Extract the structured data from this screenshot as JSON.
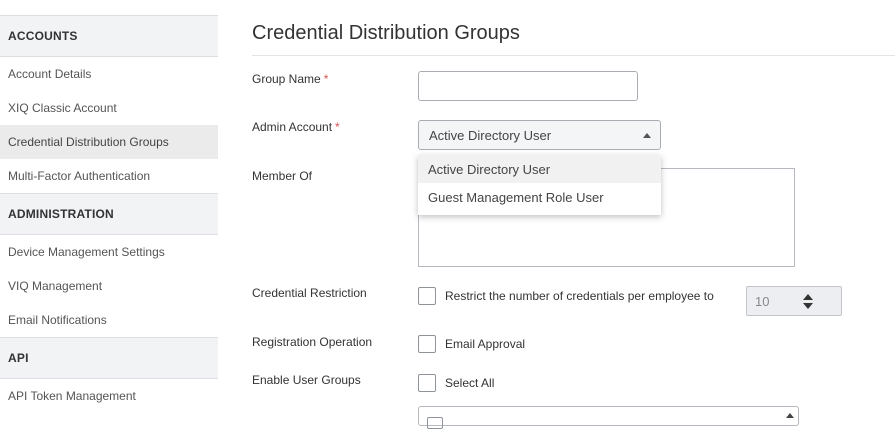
{
  "sidebar": {
    "sections": [
      {
        "title": "ACCOUNTS",
        "items": [
          "Account Details",
          "XIQ Classic Account",
          "Credential Distribution Groups",
          "Multi-Factor Authentication"
        ]
      },
      {
        "title": "ADMINISTRATION",
        "items": [
          "Device Management Settings",
          "VIQ Management",
          "Email Notifications"
        ]
      },
      {
        "title": "API",
        "items": [
          "API Token Management"
        ]
      }
    ],
    "active_item": "Credential Distribution Groups"
  },
  "main": {
    "title": "Credential Distribution Groups",
    "fields": {
      "group_name": {
        "label": "Group Name",
        "required_mark": "*",
        "value": ""
      },
      "admin_account": {
        "label": "Admin Account",
        "required_mark": "*",
        "selected": "Active Directory User",
        "options": [
          "Active Directory User",
          "Guest Management Role User"
        ]
      },
      "member_of": {
        "label": "Member Of"
      },
      "credential_restriction": {
        "label": "Credential Restriction",
        "checkbox_label": "Restrict the number of credentials per employee to",
        "checked": false,
        "count": "10"
      },
      "registration_operation": {
        "label": "Registration Operation",
        "checkbox_label": "Email Approval",
        "checked": false
      },
      "enable_user_groups": {
        "label": "Enable User Groups",
        "checkbox_label": "Select All",
        "checked": false
      }
    }
  },
  "colors": {
    "required": "#d9534f",
    "section_bg": "#f2f3f5",
    "active_bg": "#ebebec"
  }
}
